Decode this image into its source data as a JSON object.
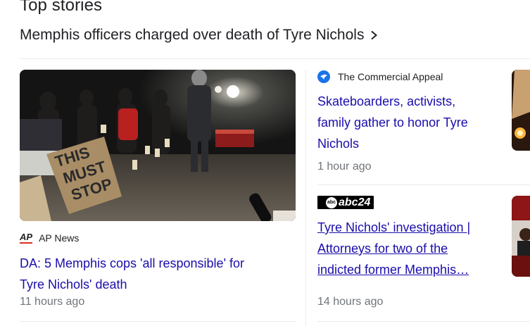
{
  "section_title": "Top stories",
  "topic": {
    "label": "Memphis officers charged over death of Tyre Nichols"
  },
  "stories": [
    {
      "source": "AP News",
      "source_logo_text": "AP",
      "headline_line1": "DA: 5 Memphis cops 'all responsible' for",
      "headline_line2": "Tyre Nichols' death",
      "time": "11 hours ago",
      "image_sign_lines": [
        "THIS",
        "MUST",
        "STOP"
      ]
    },
    {
      "source": "The Commercial Appeal",
      "headline_lines": [
        "Skateboarders, activists,",
        "family gather to honor Tyre",
        "Nichols"
      ],
      "time": "1 hour ago"
    },
    {
      "source_logo_text": "abc24",
      "headline_lines": [
        "Tyre Nichols' investigation |",
        "Attorneys for two of the",
        "indicted former Memphis…"
      ],
      "time": "14 hours ago"
    }
  ],
  "colors": {
    "link": "#1a0dab",
    "meta": "#70757a",
    "divider": "#ebebeb",
    "ap_red": "#d93025",
    "ca_blue": "#1a73e8"
  }
}
